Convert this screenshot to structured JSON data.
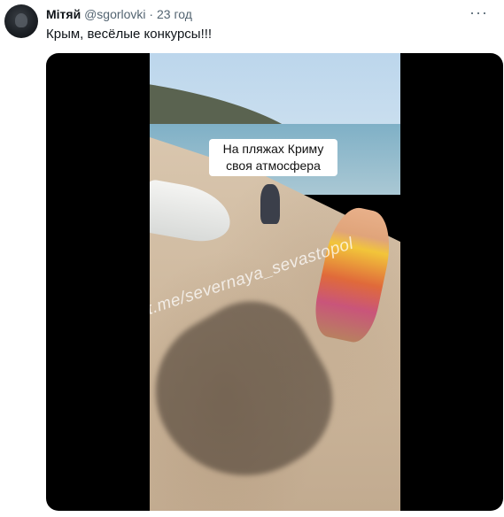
{
  "tweet": {
    "author_name": "Мітяй",
    "author_handle": "@sgorlovki",
    "separator": "·",
    "time": "23 год",
    "more_label": "···",
    "text": "Крым, весёлые конкурсы!!!",
    "media": {
      "overlay_caption_line1": "На пляжах Криму",
      "overlay_caption_line2": "своя атмосфера",
      "watermark": "t.me/severnaya_sevastopol"
    }
  }
}
